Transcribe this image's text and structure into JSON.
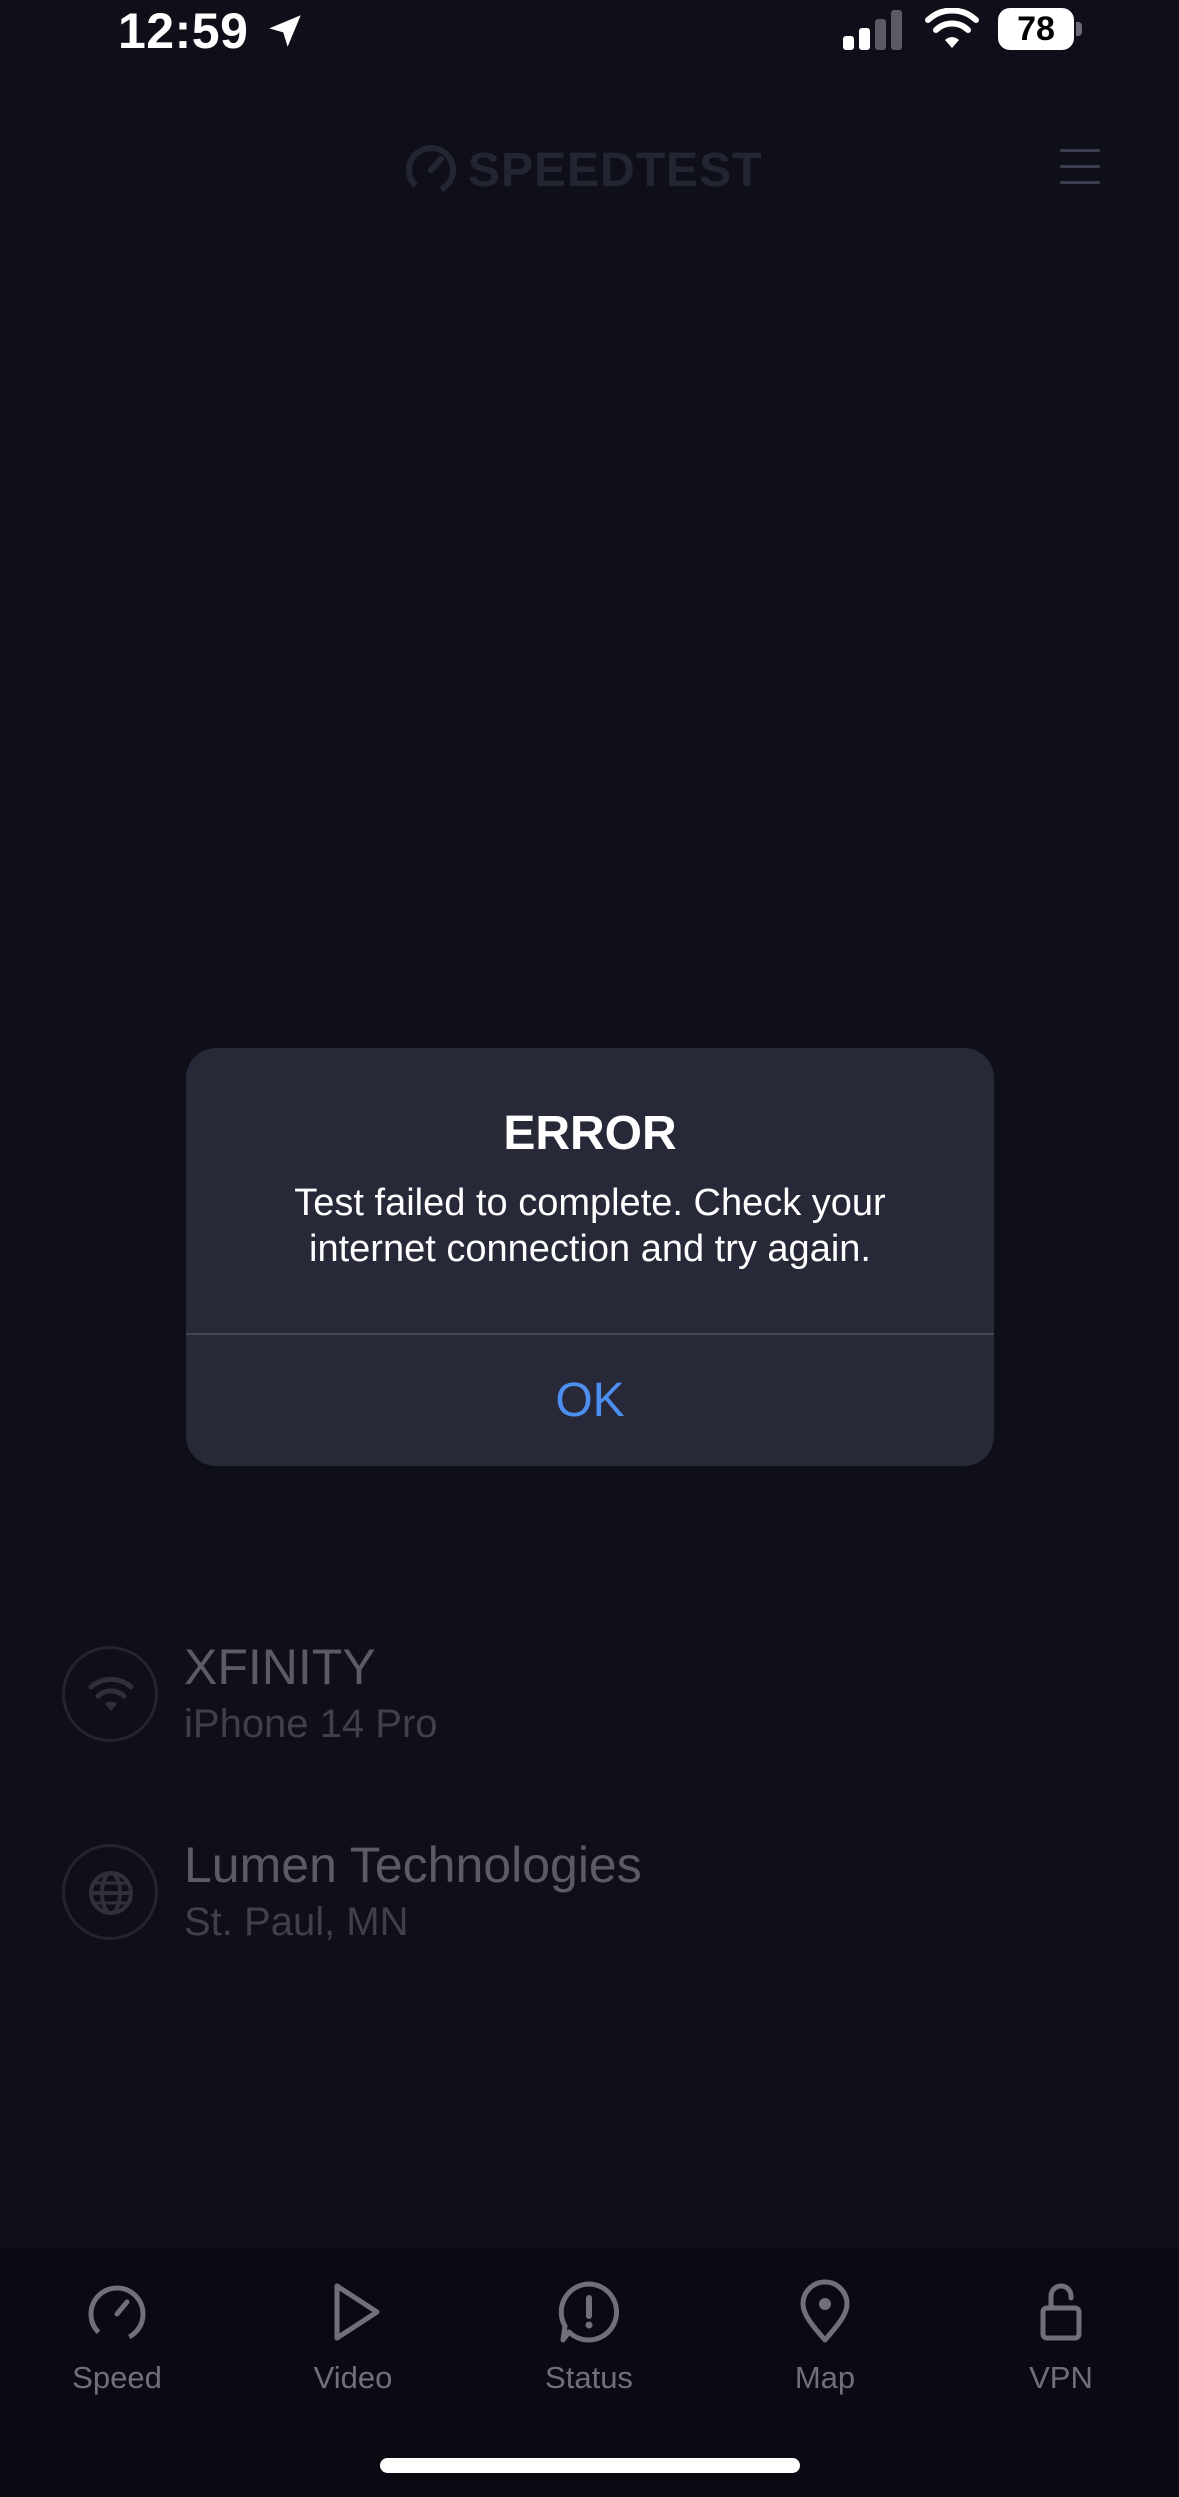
{
  "status_bar": {
    "time": "12:59",
    "battery_level": "78",
    "icons": [
      "location-arrow-icon",
      "cellular-signal-icon",
      "wifi-icon",
      "battery-icon"
    ]
  },
  "header": {
    "logo_text": "SPEEDTEST",
    "menu_icon": "hamburger-menu-icon"
  },
  "connection": {
    "network_name": "XFINITY",
    "device": "iPhone 14 Pro",
    "icon": "wifi-icon"
  },
  "server": {
    "provider": "Lumen Technologies",
    "location": "St. Paul, MN",
    "icon": "globe-icon"
  },
  "alert": {
    "title": "ERROR",
    "message": "Test failed to complete. Check your internet connection and try again.",
    "ok_label": "OK",
    "ok_color": "#4c8ff0"
  },
  "tab_bar": {
    "tabs": [
      {
        "label": "Speed",
        "icon": "speedometer-icon"
      },
      {
        "label": "Video",
        "icon": "play-icon"
      },
      {
        "label": "Status",
        "icon": "alert-circle-icon"
      },
      {
        "label": "Map",
        "icon": "map-pin-icon"
      },
      {
        "label": "VPN",
        "icon": "unlock-icon"
      }
    ]
  },
  "colors": {
    "background": "#0f0f19",
    "alert_background": "#272838",
    "tab_bar_background": "#0a0a12",
    "accent": "#4c8ff0"
  }
}
